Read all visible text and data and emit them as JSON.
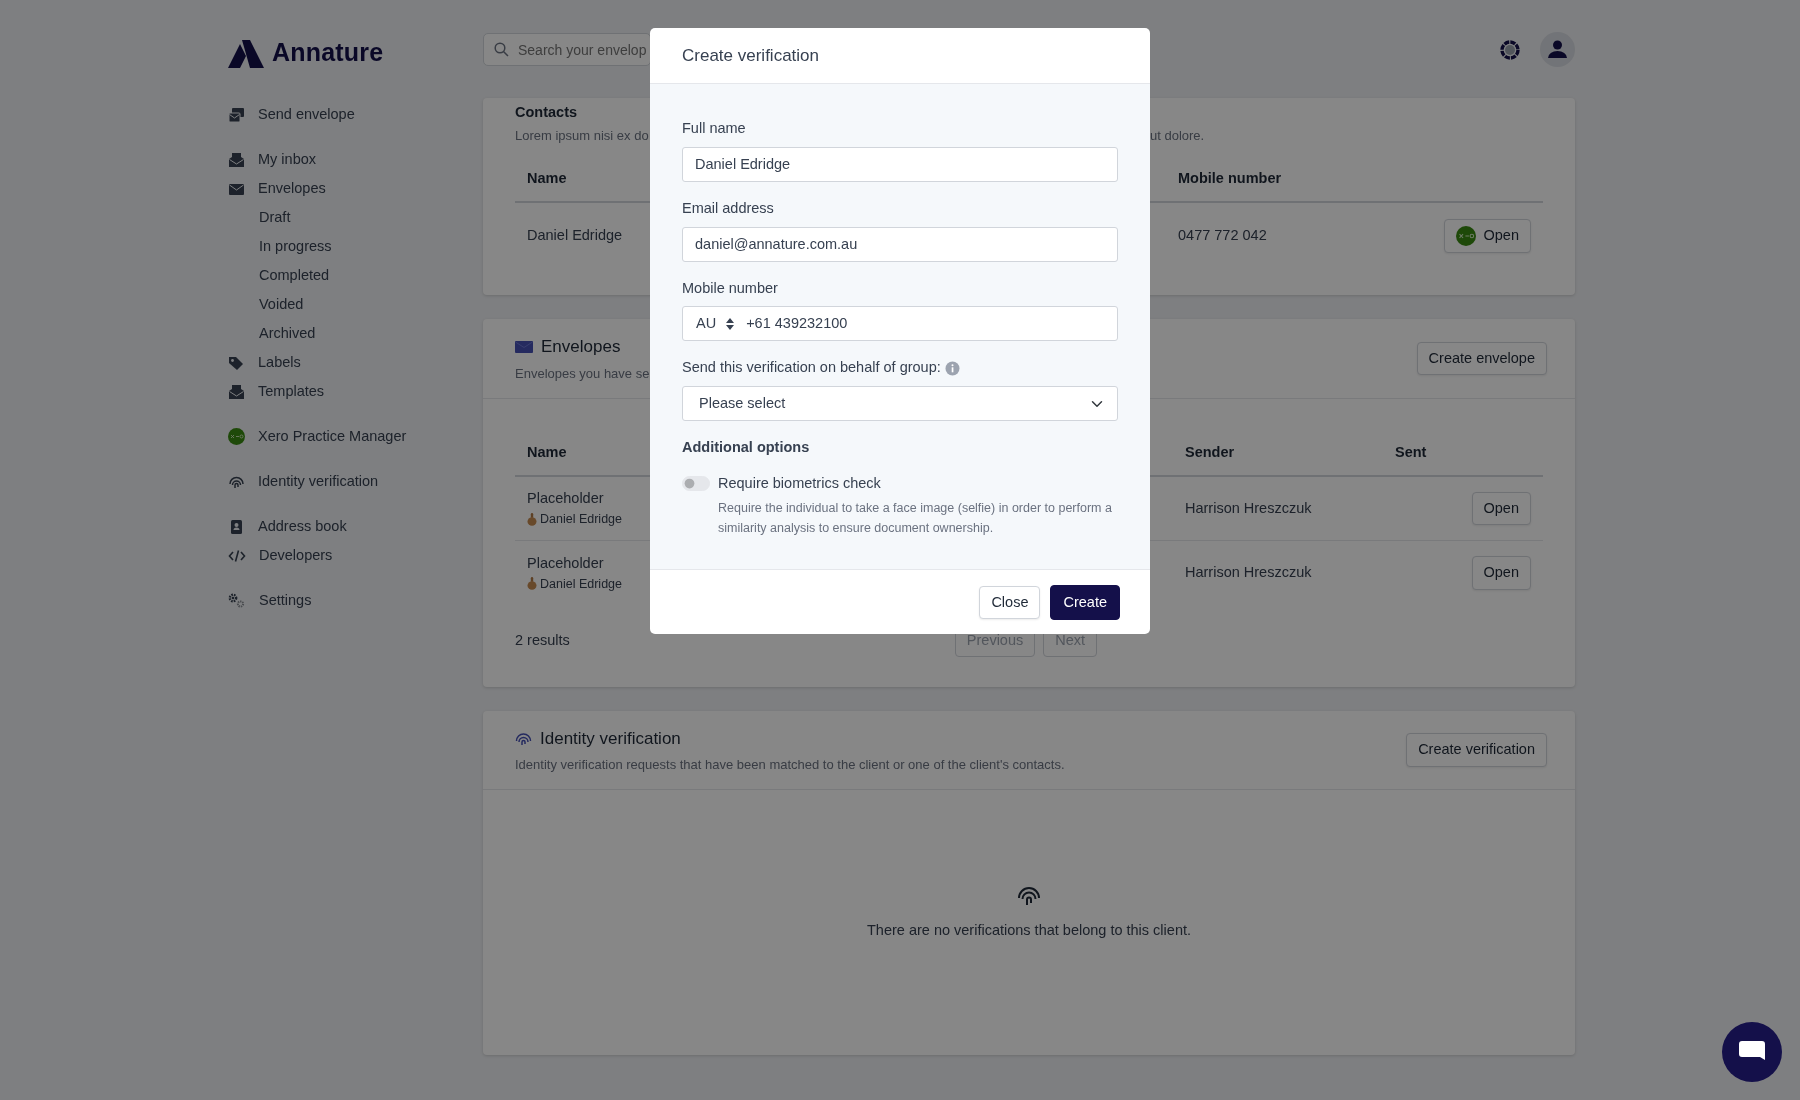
{
  "logo": {
    "text": "Annature"
  },
  "sidebar": {
    "groups": [
      {
        "items": [
          {
            "label": "Send envelope"
          }
        ]
      },
      {
        "items": [
          {
            "label": "My inbox"
          },
          {
            "label": "Envelopes",
            "children": [
              {
                "label": "Draft"
              },
              {
                "label": "In progress"
              },
              {
                "label": "Completed"
              },
              {
                "label": "Voided"
              },
              {
                "label": "Archived"
              }
            ]
          },
          {
            "label": "Labels"
          },
          {
            "label": "Templates"
          }
        ]
      },
      {
        "items": [
          {
            "label": "Xero Practice Manager"
          }
        ]
      },
      {
        "items": [
          {
            "label": "Identity verification"
          }
        ]
      },
      {
        "items": [
          {
            "label": "Address book"
          },
          {
            "label": "Developers"
          }
        ]
      },
      {
        "items": [
          {
            "label": "Settings"
          }
        ]
      }
    ]
  },
  "header": {
    "search": {
      "placeholder": "Search your envelop"
    }
  },
  "contacts": {
    "title": "Contacts",
    "description_start": "Lorem ipsum nisi ex do",
    "description_end": "ut dolore.",
    "columns": [
      {
        "label": "Name"
      },
      {
        "label": "Mobile number"
      }
    ],
    "rows": [
      {
        "name": "Daniel Edridge",
        "mobile_number": "0477 772 042",
        "button": "Open"
      }
    ]
  },
  "envelopes": {
    "title": "Envelopes",
    "description": "Envelopes you have se",
    "button": "Create envelope",
    "columns": [
      {
        "label": "Name"
      },
      {
        "label": "Sender"
      },
      {
        "label": "Sent"
      }
    ],
    "rows": [
      {
        "name": "Placeholder",
        "recipient": "Daniel Edridge",
        "sender": "Harrison Hreszczuk",
        "button": "Open"
      },
      {
        "name": "Placeholder",
        "recipient": "Daniel Edridge",
        "sender": "Harrison Hreszczuk",
        "button": "Open"
      }
    ],
    "results": "2 results",
    "pagination": [
      {
        "label": "Previous",
        "disabled": true
      },
      {
        "label": "Next",
        "disabled": true
      }
    ]
  },
  "identity": {
    "title": "Identity verification",
    "description": "Identity verification requests that have been matched to the client or one of the client's contacts.",
    "button": "Create verification",
    "empty_text": "There are no verifications that belong to this client."
  },
  "modal": {
    "title": "Create verification",
    "fields": [
      {
        "kind": "text",
        "label": "Full name",
        "value": "Daniel Edridge",
        "info": false
      },
      {
        "kind": "text",
        "label": "Email address",
        "value": "daniel@annature.com.au",
        "info": false
      },
      {
        "kind": "phone",
        "label": "Mobile number",
        "country": "AU",
        "value": "+61 439232100",
        "info": false
      },
      {
        "kind": "select",
        "label": "Send this verification on behalf of group:",
        "value": "Please select",
        "info": true
      }
    ],
    "options_heading": "Additional options",
    "toggle": {
      "label": "Require biometrics check",
      "description": "Require the individual to take a face image (selfie) in order to perform a similarity analysis to ensure document ownership.",
      "on": false
    },
    "buttons": [
      {
        "label": "Close",
        "kind": "secondary"
      },
      {
        "label": "Create",
        "kind": "primary"
      }
    ]
  }
}
